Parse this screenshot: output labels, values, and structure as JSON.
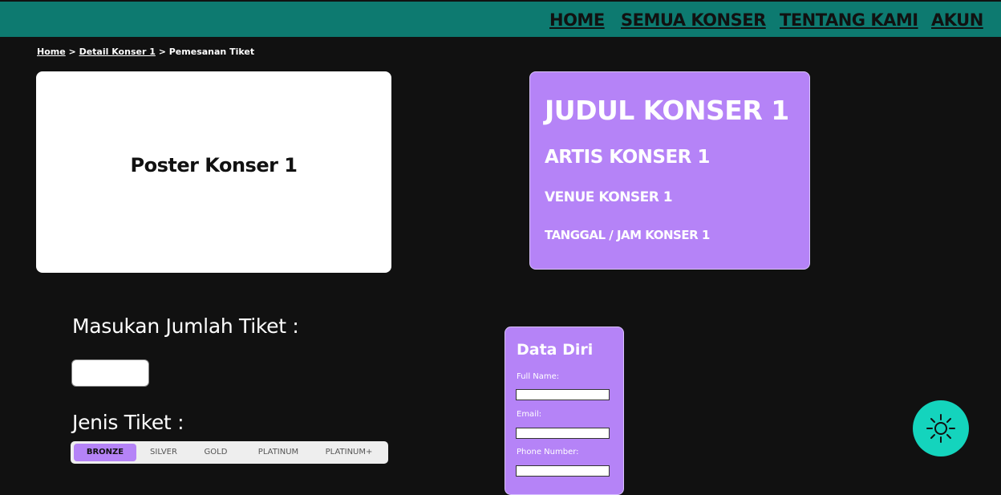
{
  "nav": {
    "items": [
      {
        "label": "HOME"
      },
      {
        "label": "SEMUA KONSER"
      },
      {
        "label": "TENTANG KAMI"
      },
      {
        "label": "AKUN"
      }
    ]
  },
  "breadcrumb": {
    "home": "Home",
    "sep1": " > ",
    "detail": "Detail Konser 1",
    "sep2": " > ",
    "current": "Pemesanan Tiket"
  },
  "poster": {
    "label": "Poster Konser 1"
  },
  "concert": {
    "title": "JUDUL KONSER 1",
    "artist": "ARTIS KONSER 1",
    "venue": "VENUE KONSER 1",
    "datetime": "TANGGAL / JAM KONSER 1"
  },
  "quantity": {
    "label": "Masukan Jumlah Tiket :",
    "value": ""
  },
  "ticket_type": {
    "label": "Jenis Tiket :",
    "options": [
      "BRONZE",
      "SILVER",
      "GOLD",
      "PLATINUM",
      "PLATINUM+"
    ],
    "selected": "BRONZE"
  },
  "form": {
    "title": "Data Diri",
    "full_name_label": "Full Name:",
    "email_label": "Email:",
    "phone_label": "Phone Number:",
    "full_name_value": "",
    "email_value": "",
    "phone_value": ""
  },
  "theme_toggle": {
    "icon": "sun-icon"
  },
  "colors": {
    "navbar": "#0d7a70",
    "background": "#111111",
    "card": "#b583f7",
    "toggle": "#14d4bd"
  }
}
